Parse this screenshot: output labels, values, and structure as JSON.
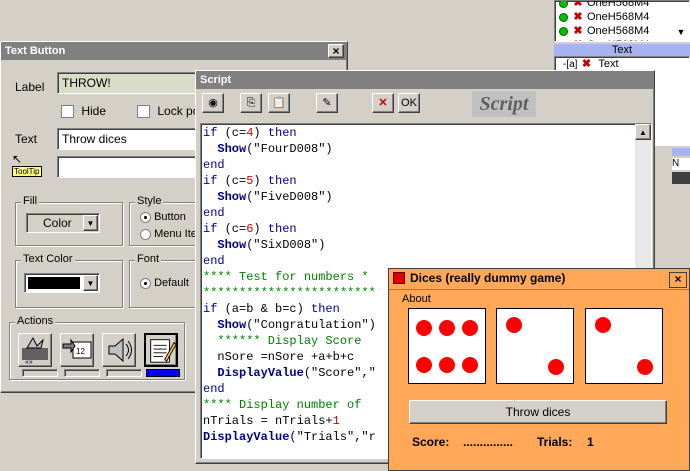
{
  "right_panel": {
    "tree_items": [
      "OneH568M4",
      "OneH568M4",
      "OneH568M4",
      "OneH568M4"
    ],
    "section_header": "Text",
    "text_item": "Text",
    "partial_label": "N"
  },
  "text_button_window": {
    "title": "Text Button",
    "label_caption": "Label",
    "label_value": "THROW!",
    "hide_label": "Hide",
    "lock_label": "Lock pos",
    "text_caption": "Text",
    "text_value": "Throw dices",
    "tooltip_label": "ToolTip",
    "tooltip_value": "",
    "fill_group": "Fill",
    "fill_value": "Color",
    "style_group": "Style",
    "style_button": "Button",
    "style_menu": "Menu Ite",
    "textcolor_group": "Text Color",
    "font_group": "Font",
    "font_default": "Default",
    "actions_group": "Actions"
  },
  "script_window": {
    "title": "Script",
    "ok_label": "OK",
    "logo_text": "Script",
    "code": [
      {
        "t": "kw",
        "s": "if"
      },
      {
        "t": "line",
        "parts": [
          [
            "kw",
            "if "
          ],
          [
            "str",
            "(c="
          ],
          [
            "num",
            "4"
          ],
          [
            "str",
            ") "
          ],
          [
            "kw",
            "then"
          ]
        ]
      },
      {
        "t": "line",
        "parts": [
          [
            "str",
            "  "
          ],
          [
            "fn",
            "Show"
          ],
          [
            "str",
            "(\"FourD008\")"
          ]
        ]
      },
      {
        "t": "line",
        "parts": [
          [
            "kw",
            "end"
          ]
        ]
      },
      {
        "t": "line",
        "parts": [
          [
            "kw",
            "if "
          ],
          [
            "str",
            "(c="
          ],
          [
            "num",
            "5"
          ],
          [
            "str",
            ") "
          ],
          [
            "kw",
            "then"
          ]
        ]
      },
      {
        "t": "line",
        "parts": [
          [
            "str",
            "  "
          ],
          [
            "fn",
            "Show"
          ],
          [
            "str",
            "(\"FiveD008\")"
          ]
        ]
      },
      {
        "t": "line",
        "parts": [
          [
            "kw",
            "end"
          ]
        ]
      },
      {
        "t": "line",
        "parts": [
          [
            "kw",
            "if "
          ],
          [
            "str",
            "(c="
          ],
          [
            "num",
            "6"
          ],
          [
            "str",
            ") "
          ],
          [
            "kw",
            "then"
          ]
        ]
      },
      {
        "t": "line",
        "parts": [
          [
            "str",
            "  "
          ],
          [
            "fn",
            "Show"
          ],
          [
            "str",
            "(\"SixD008\")"
          ]
        ]
      },
      {
        "t": "line",
        "parts": [
          [
            "kw",
            "end"
          ]
        ]
      },
      {
        "t": "line",
        "parts": [
          [
            "cm",
            "**** Test for numbers *"
          ]
        ]
      },
      {
        "t": "line",
        "parts": [
          [
            "cm",
            "************************"
          ]
        ]
      },
      {
        "t": "line",
        "parts": [
          [
            "kw",
            "if "
          ],
          [
            "str",
            "(a=b & b=c) "
          ],
          [
            "kw",
            "then"
          ]
        ]
      },
      {
        "t": "line",
        "parts": [
          [
            "str",
            "  "
          ],
          [
            "fn",
            "Show"
          ],
          [
            "str",
            "(\"Congratulation\")"
          ]
        ]
      },
      {
        "t": "line",
        "parts": [
          [
            "cm",
            "  ****** Display Score "
          ]
        ]
      },
      {
        "t": "line",
        "parts": [
          [
            "str",
            "  nSore =nSore +a+b+c"
          ]
        ]
      },
      {
        "t": "line",
        "parts": [
          [
            "str",
            "  "
          ],
          [
            "fn",
            "DisplayValue"
          ],
          [
            "str",
            "(\"Score\",\""
          ]
        ]
      },
      {
        "t": "line",
        "parts": [
          [
            "kw",
            "end"
          ]
        ]
      },
      {
        "t": "line",
        "parts": [
          [
            "cm",
            "**** Display number of "
          ]
        ]
      },
      {
        "t": "line",
        "parts": [
          [
            "str",
            "nTrials = nTrials+"
          ],
          [
            "num",
            "1"
          ]
        ]
      },
      {
        "t": "line",
        "parts": [
          [
            "fn",
            "DisplayValue"
          ],
          [
            "str",
            "(\"Trials\",\"r"
          ]
        ]
      }
    ]
  },
  "dices_window": {
    "title": "Dices (really dummy game)",
    "menu_about": "About",
    "dice": [
      6,
      2,
      2
    ],
    "throw_label": "Throw dices",
    "score_label": "Score:",
    "score_value": "...............",
    "trials_label": "Trials:",
    "trials_value": "1"
  },
  "colors": {
    "dices_bg": "#ffa858",
    "pip": "#ff0000",
    "code_keyword": "#00008b",
    "code_number": "#d00000",
    "code_comment": "#008000"
  }
}
